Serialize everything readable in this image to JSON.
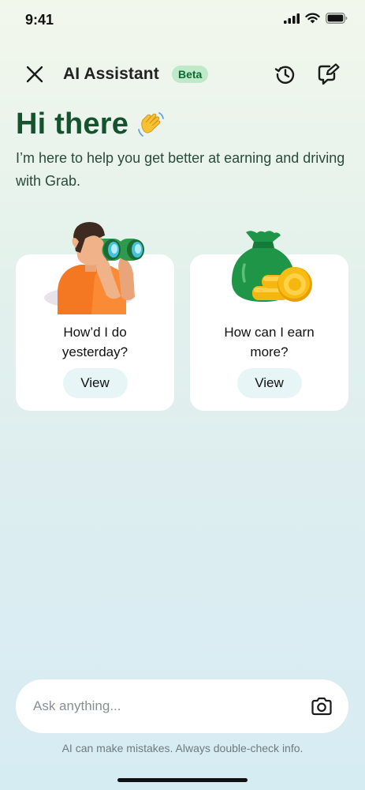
{
  "status_bar": {
    "time": "9:41",
    "icons": [
      "cellular-signal-icon",
      "wifi-icon",
      "battery-icon"
    ]
  },
  "header": {
    "title": "AI Assistant",
    "badge": "Beta",
    "icons": [
      "close-icon",
      "history-icon",
      "new-chat-icon"
    ]
  },
  "greeting": {
    "title": "Hi there",
    "emoji": "waving-hand-icon",
    "subtitle": "I’m here to help you get better at earning and driving with Grab."
  },
  "cards": [
    {
      "title": "How’d I do yesterday?",
      "button": "View",
      "illustration": "binoculars-person-illustration"
    },
    {
      "title": "How can I earn more?",
      "button": "View",
      "illustration": "money-bag-coins-illustration"
    }
  ],
  "composer": {
    "placeholder": "Ask anything...",
    "icon": "camera-icon"
  },
  "disclaimer": "AI can make mistakes. Always double-check info.",
  "colors": {
    "greeting_green": "#14532d",
    "badge_bg": "#bfe9c9",
    "badge_text": "#0e6a35",
    "view_button_bg": "#e7f5f6"
  }
}
